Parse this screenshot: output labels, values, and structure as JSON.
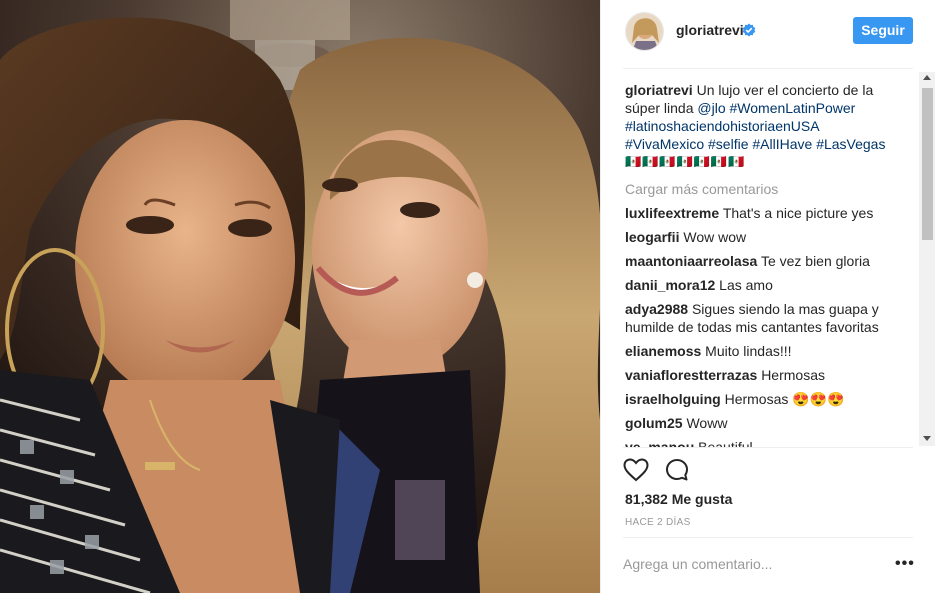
{
  "post": {
    "username": "gloriatrevi",
    "follow_label": "Seguir",
    "caption_user": "gloriatrevi",
    "caption_text_1": " Un lujo ver el concierto de la súper linda ",
    "caption_tags": {
      "jlo": "@jlo",
      "t1": "#WomenLatinPower",
      "t2": "#latinoshaciendohistoriaenUSA",
      "t3": "#VivaMexico",
      "t4": "#selfie",
      "t5": "#AllIHave",
      "t6": "#LasVegas"
    },
    "caption_emojis": "🇲🇽🇲🇽🇲🇽🇲🇽🇲🇽🇲🇽🇲🇽",
    "load_more": "Cargar más comentarios",
    "comments": [
      {
        "user": "luxlifeextreme",
        "text": "That's a nice picture yes"
      },
      {
        "user": "leogarfii",
        "text": "Wow wow"
      },
      {
        "user": "maantoniaarreolasa",
        "text": "Te vez bien gloria"
      },
      {
        "user": "danii_mora12",
        "text": "Las amo"
      },
      {
        "user": "adya2988",
        "text": "Sigues siendo la mas guapa y humilde de todas mis cantantes favoritas"
      },
      {
        "user": "elianemoss",
        "text": "Muito lindas!!!"
      },
      {
        "user": "vaniaflorestterrazas",
        "text": "Hermosas"
      },
      {
        "user": "israelholguing",
        "text": "Hermosas 😍😍😍"
      },
      {
        "user": "golum25",
        "text": "Woww"
      },
      {
        "user": "ve_manou",
        "text": "Beautiful"
      }
    ],
    "likes": "81,382 Me gusta",
    "time": "HACE 2 DÍAS",
    "add_comment_placeholder": "Agrega un comentario...",
    "more_glyph": "•••"
  },
  "colors": {
    "follow_button": "#3897f0",
    "hashtag": "#003569",
    "muted": "#999999",
    "verified": "#3897f0"
  },
  "icons": [
    "verified-badge-icon",
    "heart-icon",
    "comment-icon",
    "more-options-icon"
  ]
}
